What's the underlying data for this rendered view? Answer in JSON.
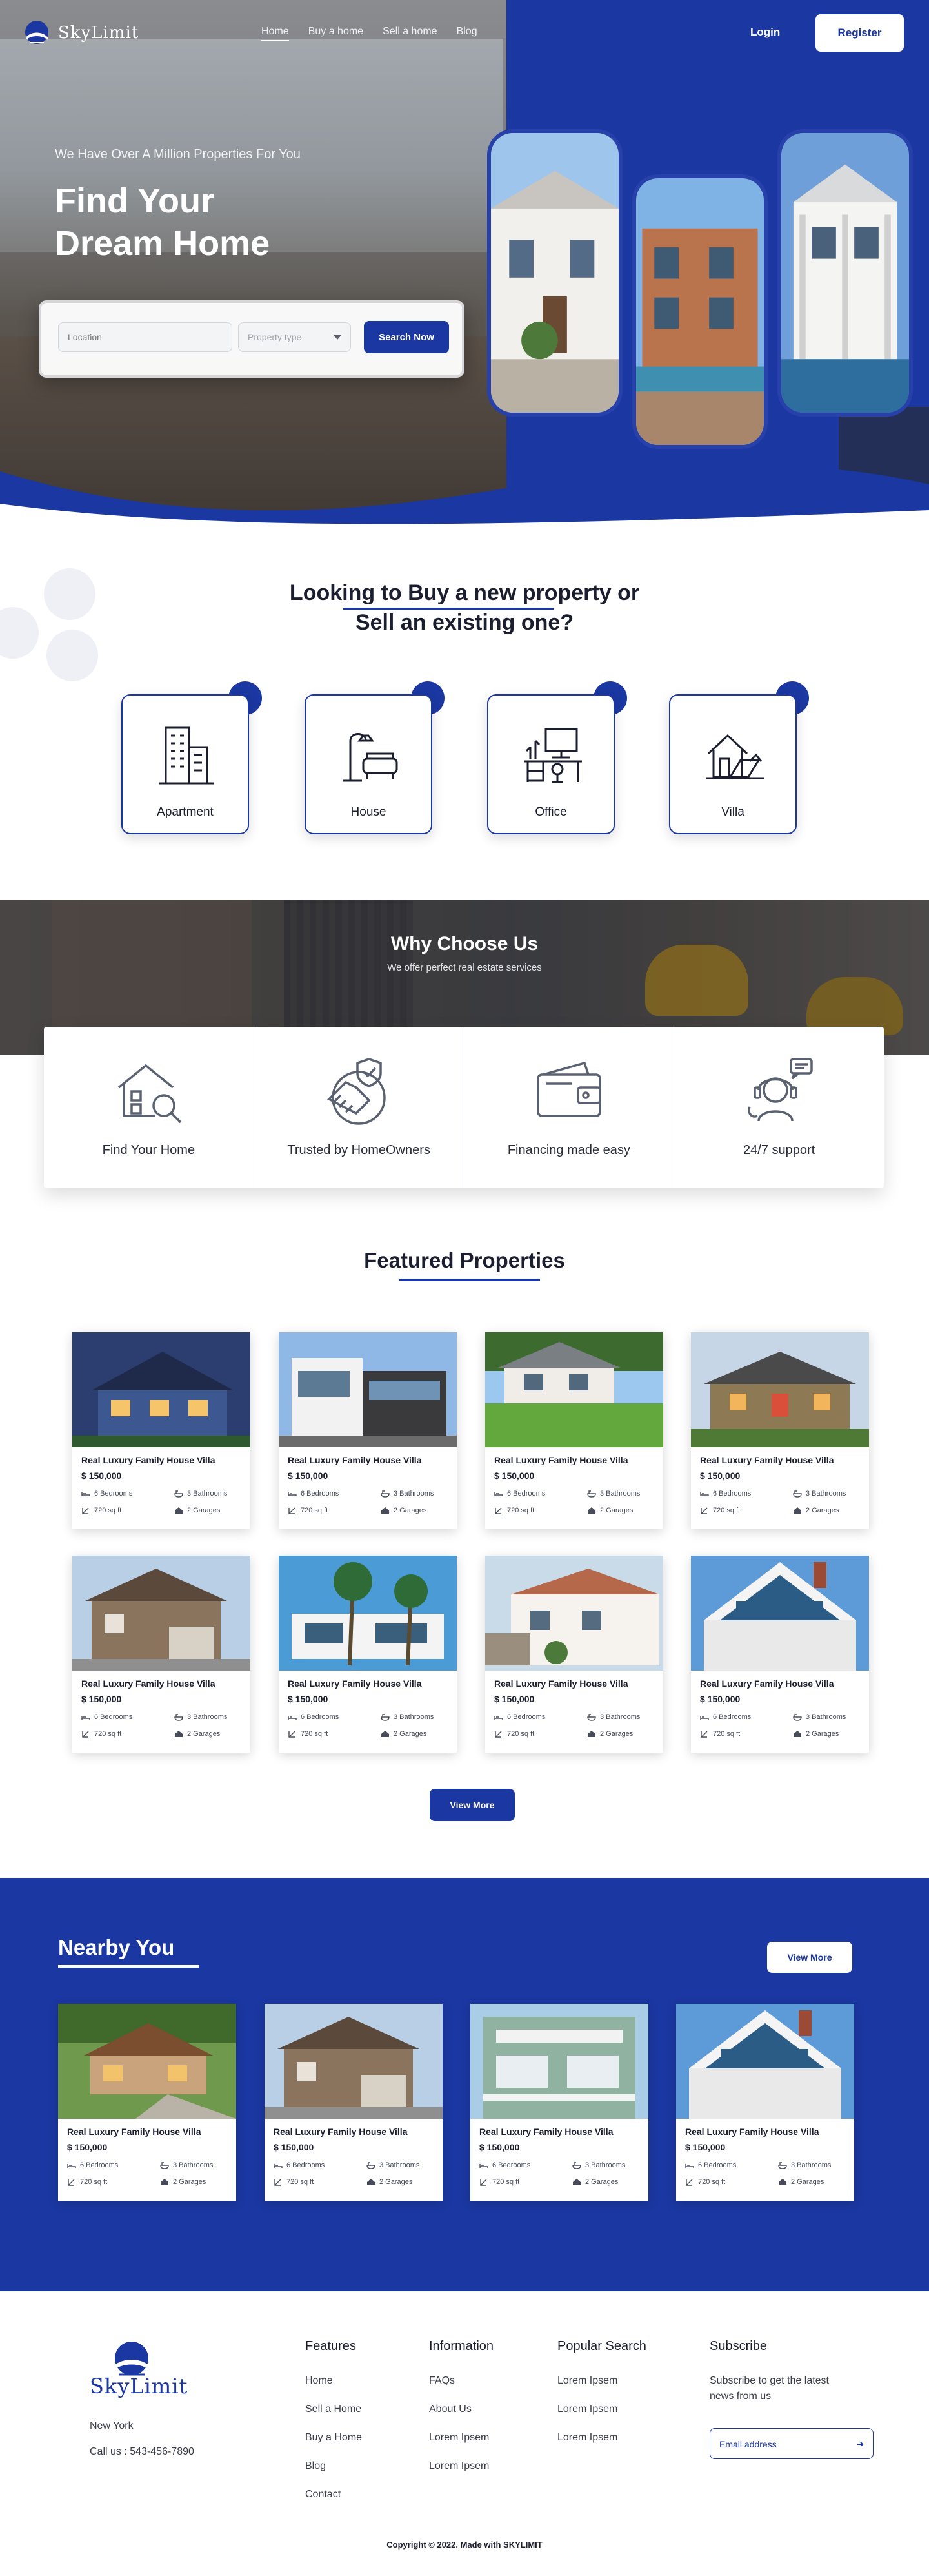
{
  "brand": {
    "name": "SkyLimit"
  },
  "nav": {
    "links": [
      "Home",
      "Buy a home",
      "Sell a home",
      "Blog"
    ],
    "login": "Login",
    "register": "Register"
  },
  "hero": {
    "eyebrow": "We Have Over A Million Properties For You",
    "title_line1": "Find Your",
    "title_line2": "Dream Home",
    "search": {
      "location_placeholder": "Location",
      "type_placeholder": "Property type",
      "button": "Search Now"
    }
  },
  "buy_section": {
    "heading_line1": "Looking to Buy a new property or",
    "heading_line2": "Sell an existing one?",
    "types": [
      {
        "label": "Apartment",
        "icon": "apartment-icon"
      },
      {
        "label": "House",
        "icon": "house-icon"
      },
      {
        "label": "Office",
        "icon": "office-icon"
      },
      {
        "label": "Villa",
        "icon": "villa-icon"
      }
    ]
  },
  "why": {
    "title": "Why Choose Us",
    "subtitle": "We offer perfect real estate services",
    "items": [
      {
        "label": "Find Your Home",
        "icon": "house-search-icon"
      },
      {
        "label": "Trusted by HomeOwners",
        "icon": "handshake-shield-icon"
      },
      {
        "label": "Financing made easy",
        "icon": "wallet-icon"
      },
      {
        "label": "24/7 support",
        "icon": "support-agent-icon"
      }
    ]
  },
  "featured": {
    "title": "Featured Properties",
    "view_more": "View More",
    "properties": [
      {
        "title": "Real Luxury Family House Villa",
        "price": "$ 150,000",
        "bedrooms": "6 Bedrooms",
        "bathrooms": "3 Bathrooms",
        "area": "720 sq ft",
        "garages": "2 Garages"
      },
      {
        "title": "Real Luxury Family House Villa",
        "price": "$ 150,000",
        "bedrooms": "6 Bedrooms",
        "bathrooms": "3 Bathrooms",
        "area": "720 sq ft",
        "garages": "2 Garages"
      },
      {
        "title": "Real Luxury Family House Villa",
        "price": "$ 150,000",
        "bedrooms": "6 Bedrooms",
        "bathrooms": "3 Bathrooms",
        "area": "720 sq ft",
        "garages": "2 Garages"
      },
      {
        "title": "Real Luxury Family House Villa",
        "price": "$ 150,000",
        "bedrooms": "6 Bedrooms",
        "bathrooms": "3 Bathrooms",
        "area": "720 sq ft",
        "garages": "2 Garages"
      },
      {
        "title": "Real Luxury Family House Villa",
        "price": "$ 150,000",
        "bedrooms": "6 Bedrooms",
        "bathrooms": "3 Bathrooms",
        "area": "720 sq ft",
        "garages": "2 Garages"
      },
      {
        "title": "Real Luxury Family House Villa",
        "price": "$ 150,000",
        "bedrooms": "6 Bedrooms",
        "bathrooms": "3 Bathrooms",
        "area": "720 sq ft",
        "garages": "2 Garages"
      },
      {
        "title": "Real Luxury Family House Villa",
        "price": "$ 150,000",
        "bedrooms": "6 Bedrooms",
        "bathrooms": "3 Bathrooms",
        "area": "720 sq ft",
        "garages": "2 Garages"
      },
      {
        "title": "Real Luxury Family House Villa",
        "price": "$ 150,000",
        "bedrooms": "6 Bedrooms",
        "bathrooms": "3 Bathrooms",
        "area": "720 sq ft",
        "garages": "2 Garages"
      }
    ]
  },
  "nearby": {
    "title": "Nearby You",
    "view_more": "View More",
    "properties": [
      {
        "title": "Real Luxury Family House Villa",
        "price": "$ 150,000",
        "bedrooms": "6 Bedrooms",
        "bathrooms": "3 Bathrooms",
        "area": "720 sq ft",
        "garages": "2 Garages"
      },
      {
        "title": "Real Luxury Family House Villa",
        "price": "$ 150,000",
        "bedrooms": "6 Bedrooms",
        "bathrooms": "3 Bathrooms",
        "area": "720 sq ft",
        "garages": "2 Garages"
      },
      {
        "title": "Real Luxury Family House Villa",
        "price": "$ 150,000",
        "bedrooms": "6 Bedrooms",
        "bathrooms": "3 Bathrooms",
        "area": "720 sq ft",
        "garages": "2 Garages"
      },
      {
        "title": "Real Luxury Family House Villa",
        "price": "$ 150,000",
        "bedrooms": "6 Bedrooms",
        "bathrooms": "3 Bathrooms",
        "area": "720 sq ft",
        "garages": "2 Garages"
      }
    ]
  },
  "footer": {
    "brand": "SkyLimit",
    "city": "New York",
    "phone": "Call us : 543-456-7890",
    "features": {
      "title": "Features",
      "links": [
        "Home",
        "Sell a Home",
        "Buy a Home",
        "Blog",
        "Contact"
      ]
    },
    "information": {
      "title": "Information",
      "links": [
        "FAQs",
        "About Us",
        "Lorem Ipsem",
        "Lorem Ipsem"
      ]
    },
    "popular": {
      "title": "Popular Search",
      "links": [
        "Lorem Ipsem",
        "Lorem Ipsem",
        "Lorem Ipsem"
      ]
    },
    "subscribe": {
      "title": "Subscribe",
      "description": "Subscribe to get the latest news from us",
      "placeholder": "Email address"
    },
    "copyright": "Copyright © 2022. Made with SKYLIMIT"
  },
  "colors": {
    "brand_blue": "#1b37a1",
    "white": "#ffffff",
    "text_dark": "#1b1e2e"
  }
}
